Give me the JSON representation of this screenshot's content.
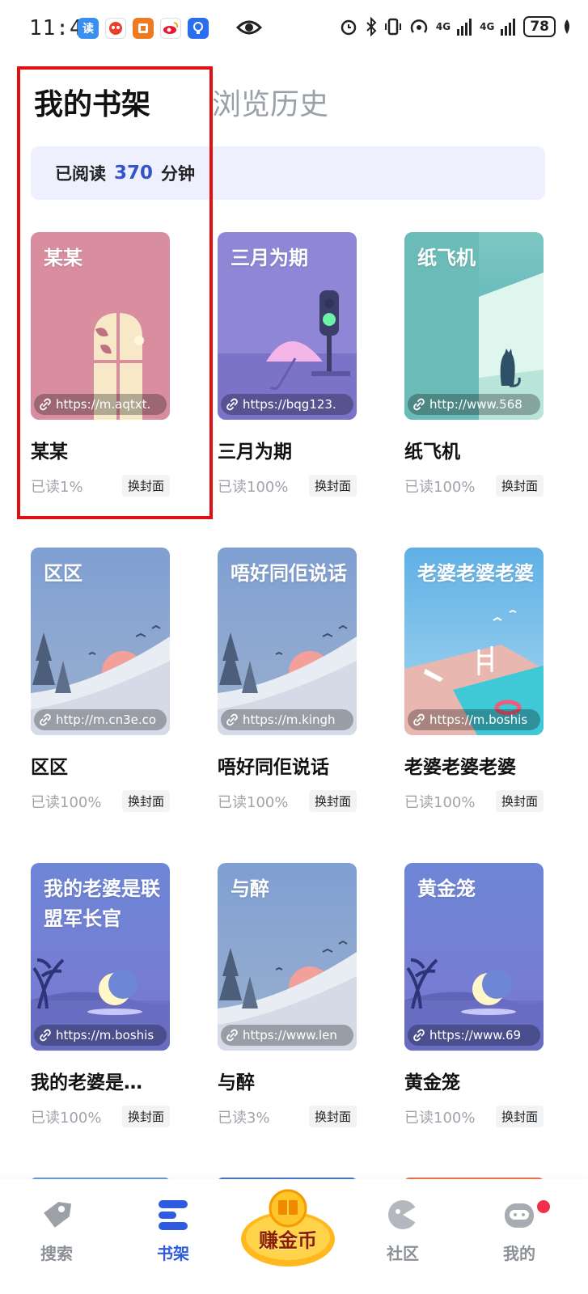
{
  "status_bar": {
    "time": "11:43",
    "battery": "78",
    "signal_labels": [
      "4G",
      "4G"
    ]
  },
  "tabs": [
    {
      "label": "我的书架",
      "active": true
    },
    {
      "label": "浏览历史",
      "active": false
    }
  ],
  "reading": {
    "prefix": "已阅读",
    "minutes": "370",
    "suffix": "分钟"
  },
  "books": [
    {
      "cover_title": "某某",
      "url": "https://m.aqtxt.",
      "title": "某某",
      "progress": "已读1%",
      "button": "换封面",
      "theme": "pink-window"
    },
    {
      "cover_title": "三月为期",
      "url": "https://bqg123.",
      "title": "三月为期",
      "progress": "已读100%",
      "button": "换封面",
      "theme": "purple-umbrella"
    },
    {
      "cover_title": "纸飞机",
      "url": "http://www.568",
      "title": "纸飞机",
      "progress": "已读100%",
      "button": "换封面",
      "theme": "teal-cat"
    },
    {
      "cover_title": "区区",
      "url": "http://m.cn3e.co",
      "title": "区区",
      "progress": "已读100%",
      "button": "换封面",
      "theme": "blue-mountain"
    },
    {
      "cover_title": "唔好同佢说话",
      "url": "https://m.kingh",
      "title": "唔好同佢说话",
      "progress": "已读100%",
      "button": "换封面",
      "theme": "blue-mountain"
    },
    {
      "cover_title": "老婆老婆老婆",
      "url": "https://m.boshis",
      "title": "老婆老婆老婆",
      "progress": "已读100%",
      "button": "换封面",
      "theme": "sky-pool"
    },
    {
      "cover_title": "我的老婆是联盟军长官",
      "url": "https://m.boshis",
      "title": "我的老婆是…",
      "progress": "已读100%",
      "button": "换封面",
      "theme": "night-moon"
    },
    {
      "cover_title": "与醉",
      "url": "https://www.len",
      "title": "与醉",
      "progress": "已读3%",
      "button": "换封面",
      "theme": "blue-mountain"
    },
    {
      "cover_title": "黄金笼",
      "url": "https://www.69",
      "title": "黄金笼",
      "progress": "已读100%",
      "button": "换封面",
      "theme": "night-moon"
    }
  ],
  "bottom_nav": {
    "search": "搜索",
    "shelf": "书架",
    "earn": "赚金币",
    "community": "社区",
    "mine": "我的"
  },
  "colors": {
    "accent": "#2f5be0",
    "reading_number": "#3355c8",
    "highlight_box": "#e01010"
  }
}
